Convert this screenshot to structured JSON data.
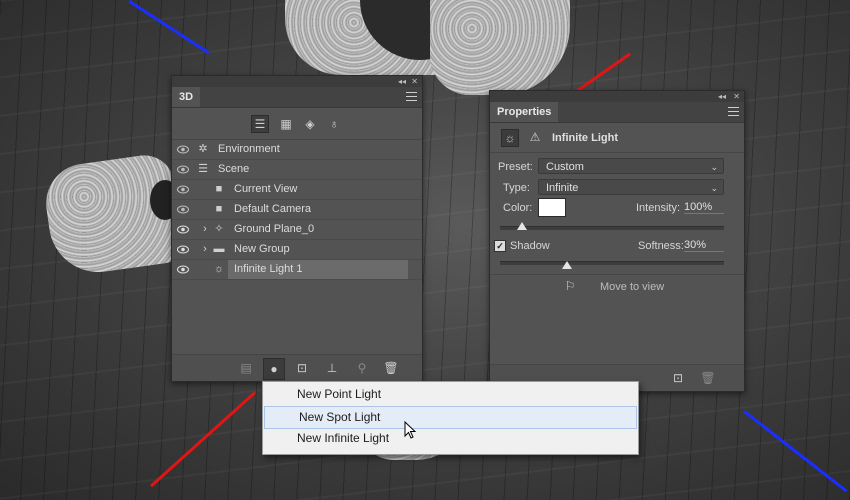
{
  "panel_3d": {
    "tab_label": "3D",
    "rows": [
      {
        "label": "Environment",
        "icon": "environment-icon"
      },
      {
        "label": "Scene",
        "icon": "scene-icon"
      },
      {
        "label": "Current View",
        "icon": "camera-icon"
      },
      {
        "label": "Default Camera",
        "icon": "camera-icon"
      },
      {
        "label": "Ground Plane_0",
        "icon": "ground-plane-icon"
      },
      {
        "label": "New Group",
        "icon": "folder-icon"
      },
      {
        "label": "Infinite Light 1",
        "icon": "infinite-light-icon"
      }
    ],
    "filter_icons": [
      "whole-scene-filter-icon",
      "meshes-filter-icon",
      "materials-filter-icon",
      "lights-filter-icon"
    ],
    "bottom_icons": [
      "render-icon",
      "add-light-icon",
      "add-object-icon",
      "drop-to-plane-icon",
      "constrain-icon",
      "delete-icon"
    ]
  },
  "properties_panel": {
    "tab_label": "Properties",
    "header_title": "Infinite Light",
    "preset_label": "Preset:",
    "preset_value": "Custom",
    "type_label": "Type:",
    "type_value": "Infinite",
    "color_label": "Color:",
    "color_value": "#ffffff",
    "intensity_label": "Intensity:",
    "intensity_value": "100%",
    "intensity_level": 0.1,
    "shadow_label": "Shadow",
    "shadow_checked": true,
    "softness_label": "Softness:",
    "softness_value": "30%",
    "softness_level": 0.3,
    "move_to_view_label": "Move to view"
  },
  "light_menu": {
    "items": [
      "New Point Light",
      "New Spot Light",
      "New Infinite Light"
    ],
    "highlighted_index": 1
  }
}
